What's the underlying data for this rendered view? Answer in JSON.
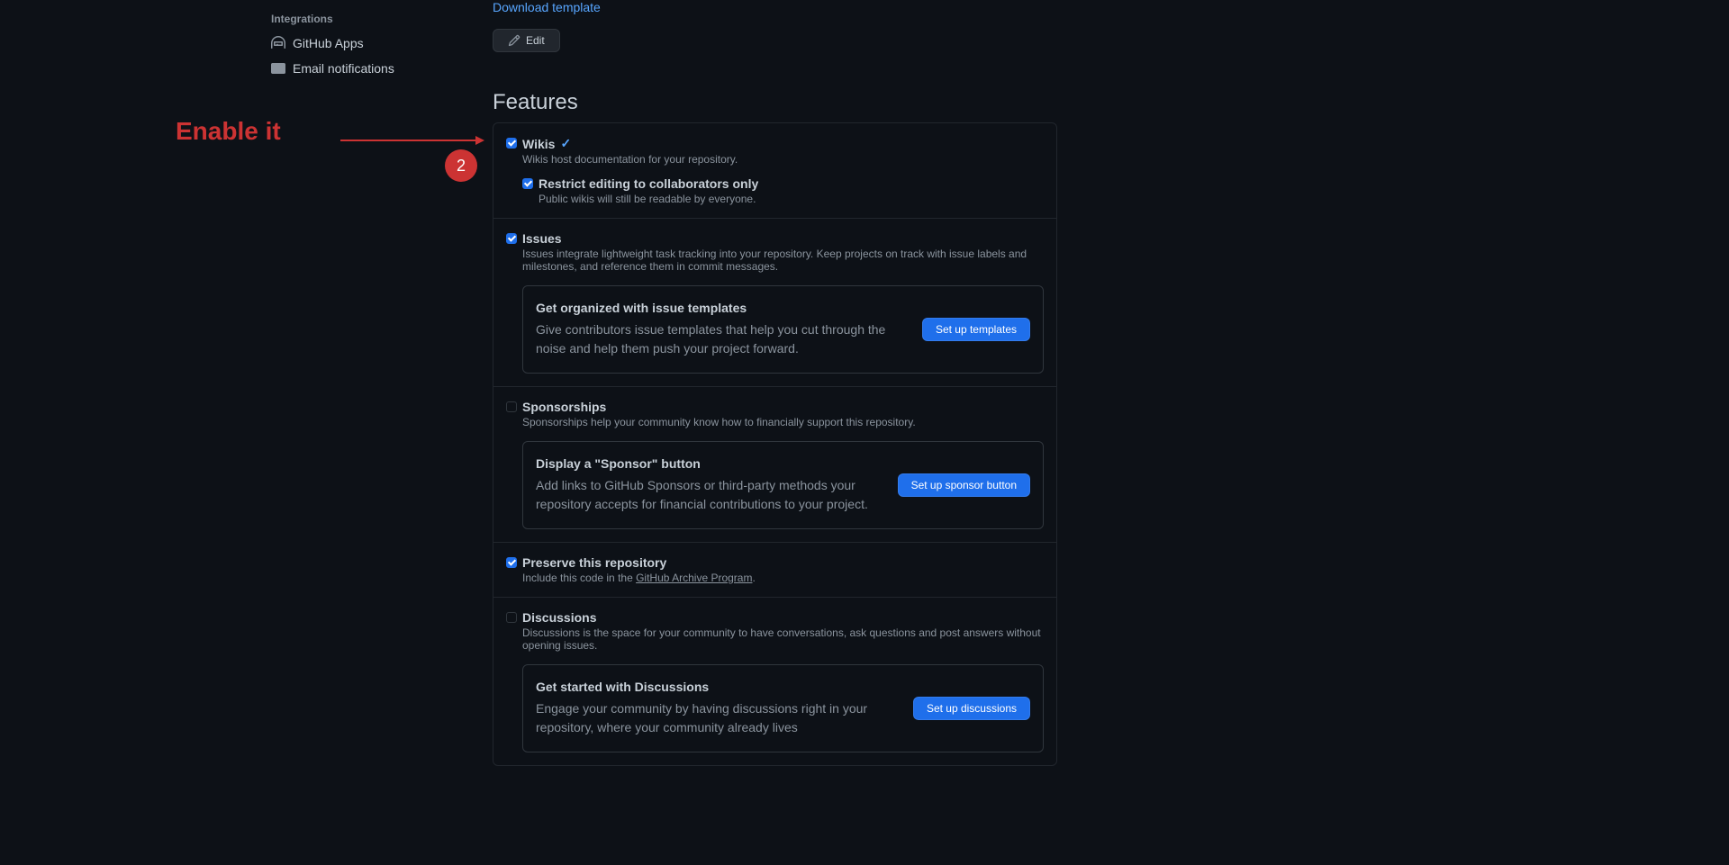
{
  "sidebar": {
    "heading": "Integrations",
    "items": [
      {
        "label": "GitHub Apps"
      },
      {
        "label": "Email notifications"
      }
    ]
  },
  "social": {
    "download_link": "Download template",
    "edit_button": "Edit"
  },
  "features_heading": "Features",
  "features": {
    "wikis": {
      "title": "Wikis",
      "desc": "Wikis host documentation for your repository.",
      "restrict_title": "Restrict editing to collaborators only",
      "restrict_desc": "Public wikis will still be readable by everyone."
    },
    "issues": {
      "title": "Issues",
      "desc": "Issues integrate lightweight task tracking into your repository. Keep projects on track with issue labels and milestones, and reference them in commit messages.",
      "promo_title": "Get organized with issue templates",
      "promo_desc": "Give contributors issue templates that help you cut through the noise and help them push your project forward.",
      "promo_button": "Set up templates"
    },
    "sponsorships": {
      "title": "Sponsorships",
      "desc": "Sponsorships help your community know how to financially support this repository.",
      "promo_title": "Display a \"Sponsor\" button",
      "promo_desc": "Add links to GitHub Sponsors or third-party methods your repository accepts for financial contributions to your project.",
      "promo_button": "Set up sponsor button"
    },
    "preserve": {
      "title": "Preserve this repository",
      "desc_prefix": "Include this code in the ",
      "desc_link": "GitHub Archive Program",
      "desc_suffix": "."
    },
    "discussions": {
      "title": "Discussions",
      "desc": "Discussions is the space for your community to have conversations, ask questions and post answers without opening issues.",
      "promo_title": "Get started with Discussions",
      "promo_desc": "Engage your community by having discussions right in your repository, where your community already lives",
      "promo_button": "Set up discussions"
    }
  },
  "annotation": {
    "text": "Enable it",
    "badge": "2"
  }
}
